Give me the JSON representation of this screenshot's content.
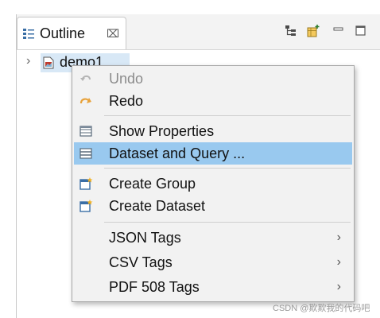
{
  "view": {
    "tab_title": "Outline",
    "tab_close": "⌧",
    "icons": {
      "tab": "outline-view-icon",
      "toolbar": [
        "tree-layout-icon",
        "new-object-icon",
        "minimize-icon",
        "maximize-icon"
      ]
    }
  },
  "tree": {
    "twisty": "›",
    "root_label": "demo1",
    "root_icon": "report-file-icon"
  },
  "context_menu": {
    "items": [
      {
        "label": "Undo",
        "icon": "undo-icon",
        "enabled": false
      },
      {
        "label": "Redo",
        "icon": "redo-icon",
        "enabled": true
      },
      {
        "label": "Show Properties",
        "icon": "properties-icon",
        "enabled": true
      },
      {
        "label": "Dataset and Query ...",
        "icon": "dataset-query-icon",
        "enabled": true,
        "highlighted": true
      },
      {
        "label": "Create Group",
        "icon": "create-group-icon",
        "enabled": true
      },
      {
        "label": "Create Dataset",
        "icon": "create-dataset-icon",
        "enabled": true
      },
      {
        "label": "JSON Tags",
        "submenu": true,
        "enabled": true
      },
      {
        "label": "CSV Tags",
        "submenu": true,
        "enabled": true
      },
      {
        "label": "PDF 508 Tags",
        "submenu": true,
        "enabled": true
      }
    ],
    "submenu_arrow": "›",
    "highlight_color": "#99c9ef"
  },
  "watermark": "CSDN @欺欺我的代码吧"
}
